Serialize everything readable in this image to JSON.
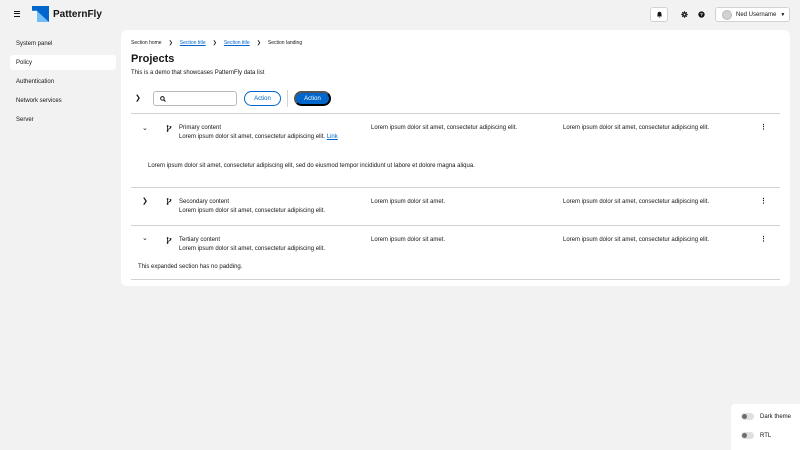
{
  "masthead": {
    "brand": "PatternFly",
    "notifications_icon": "bell-icon",
    "settings_icon": "gear-icon",
    "help_icon": "question-circle-icon",
    "user_name": "Ned Username"
  },
  "sidebar": {
    "items": [
      {
        "label": "System panel",
        "active": false
      },
      {
        "label": "Policy",
        "active": true
      },
      {
        "label": "Authentication",
        "active": false
      },
      {
        "label": "Network services",
        "active": false
      },
      {
        "label": "Server",
        "active": false
      }
    ]
  },
  "breadcrumb": {
    "items": [
      {
        "label": "Section home",
        "link": false
      },
      {
        "label": "Section title",
        "link": true
      },
      {
        "label": "Section title",
        "link": true
      },
      {
        "label": "Section landing",
        "link": false
      }
    ]
  },
  "page": {
    "title": "Projects",
    "description": "This is a demo that showcases PatternFly data list"
  },
  "toolbar": {
    "search_value": "",
    "search_placeholder": "",
    "action_secondary": "Action",
    "action_primary": "Action"
  },
  "rows": [
    {
      "expanded": true,
      "title": "Primary content",
      "subtitle": "Lorem ipsum dolor sit amet, consectetur adipiscing elit.",
      "link": "Link",
      "col2": "Lorem ipsum dolor sit amet, consectetur adipiscing elit.",
      "col3": "Lorem ipsum dolor sit amet, consectetur adipiscing elit.",
      "expanded_text": "Lorem ipsum dolor sit amet, consectetur adipiscing elit, sed do eiusmod tempor incididunt ut labore et dolore magna aliqua."
    },
    {
      "expanded": false,
      "title": "Secondary content",
      "subtitle": "Lorem ipsum dolor sit amet, consectetur adipiscing elit.",
      "col2": "Lorem ipsum dolor sit amet.",
      "col3": "Lorem ipsum dolor sit amet, consectetur adipiscing elit."
    },
    {
      "expanded": true,
      "title": "Tertiary content",
      "subtitle": "Lorem ipsum dolor sit amet, consectetur adipiscing elit.",
      "col2": "Lorem ipsum dolor sit amet.",
      "col3": "Lorem ipsum dolor sit amet, consectetur adipiscing elit.",
      "expanded_text": "This expanded section has no padding."
    }
  ],
  "theme_panel": {
    "dark_theme_label": "Dark theme",
    "dark_theme_on": false,
    "rtl_label": "RTL",
    "rtl_on": false
  },
  "colors": {
    "primary": "#0066cc",
    "page_background": "#f2f2f2",
    "border": "#d2d2d2"
  }
}
